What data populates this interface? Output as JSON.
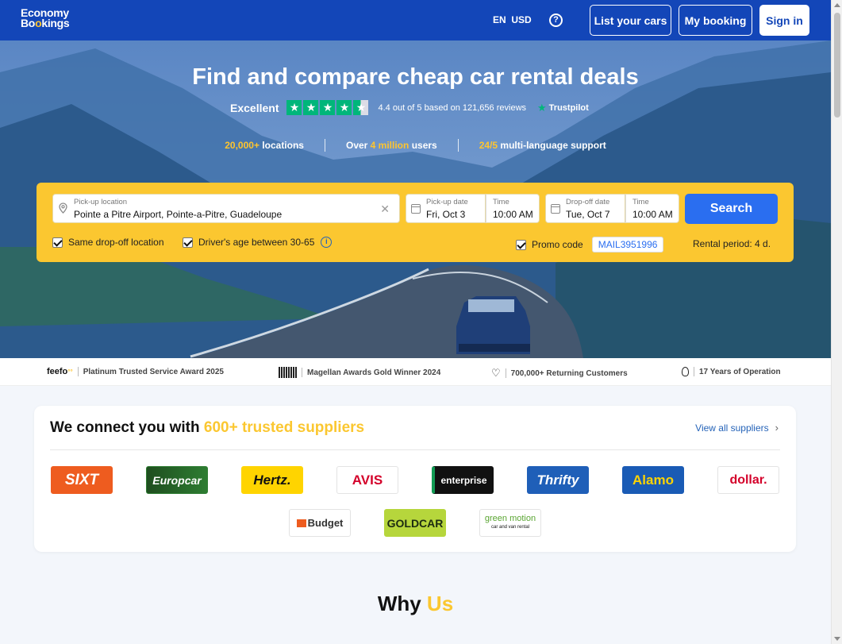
{
  "header": {
    "logo_line1": "Economy",
    "logo_line2a": "Bo",
    "logo_line2b": "o",
    "logo_line2c": "kings",
    "lang": "EN",
    "currency": "USD",
    "help_icon": "question-circle-icon",
    "list_cars": "List your cars",
    "my_booking": "My booking",
    "sign_in": "Sign in"
  },
  "hero": {
    "title": "Find and compare cheap car rental deals",
    "rating_label": "Excellent",
    "rating_text": "4.4 out of 5 based on 121,656 reviews",
    "trustpilot": "Trustpilot",
    "stat1_hl": "20,000+",
    "stat1": " locations",
    "stat2_pre": "Over ",
    "stat2_hl": "4 million",
    "stat2": " users",
    "stat3_hl": "24/5",
    "stat3": " multi-language support"
  },
  "search": {
    "pickup_location_label": "Pick-up location",
    "pickup_location_value": "Pointe a Pitre Airport, Pointe-a-Pitre, Guadeloupe",
    "pickup_date_label": "Pick-up date",
    "pickup_date_value": "Fri, Oct 3",
    "pickup_time_label": "Time",
    "pickup_time_value": "10:00 AM",
    "dropoff_date_label": "Drop-off date",
    "dropoff_date_value": "Tue, Oct 7",
    "dropoff_time_label": "Time",
    "dropoff_time_value": "10:00 AM",
    "search_button": "Search",
    "same_dropoff": "Same drop-off location",
    "driver_age": "Driver's age between 30-65",
    "promo_label": "Promo code",
    "promo_value": "MAIL3951996",
    "rental_period": "Rental period: 4 d."
  },
  "trust": {
    "feefo": "feefo",
    "award1": "Platinum Trusted Service Award 2025",
    "award2": "Magellan Awards Gold Winner 2024",
    "award3": "700,000+ Returning Customers",
    "award4": "17 Years of Operation"
  },
  "suppliers": {
    "title_pre": "We connect you with ",
    "title_hl": "600+ trusted suppliers",
    "view_all": "View all suppliers",
    "logos": [
      "SIXT",
      "Europcar",
      "Hertz.",
      "AVIS",
      "enterprise",
      "Thrifty",
      "Alamo",
      "dollar.",
      "Budget",
      "GOLDCAR",
      "green motion"
    ],
    "gm_sub": "car and van rental"
  },
  "why": {
    "pre": "Why ",
    "hl": "Us"
  },
  "colors": {
    "header_bg": "#1346b8",
    "accent_yellow": "#fbc730",
    "search_button": "#2a6ef0",
    "trustpilot_green": "#00b67a"
  }
}
